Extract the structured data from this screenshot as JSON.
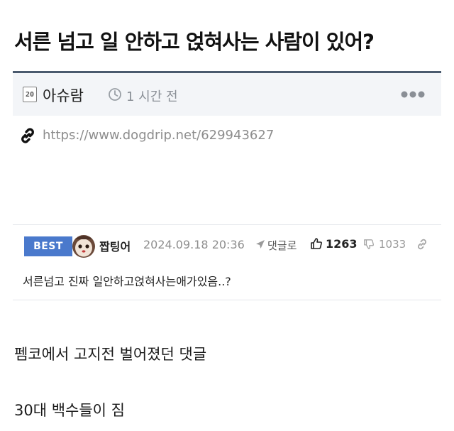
{
  "post": {
    "title": "서른 넘고 일 안하고 얹혀사는 사람이 있어?",
    "level": "20",
    "author": "아슈람",
    "time_ago": "1 시간 전",
    "link": "https://www.dogdrip.net/629943627"
  },
  "comment": {
    "badge": "BEST",
    "author": "짭팅어",
    "date": "2024.09.18 20:36",
    "reply_label": "댓글로",
    "upvotes": "1263",
    "downvotes": "1033",
    "text": "서른넘고 진짜 일안하고얹혀사는애가있음..?"
  },
  "body": {
    "line1": "펨코에서 고지전 벌어졌던 댓글",
    "line2": "30대 백수들이 짐"
  },
  "colors": {
    "title_rule": "#4a5a6e",
    "meta_bg": "#f3f5f8",
    "best_badge": "#4a79cc"
  }
}
